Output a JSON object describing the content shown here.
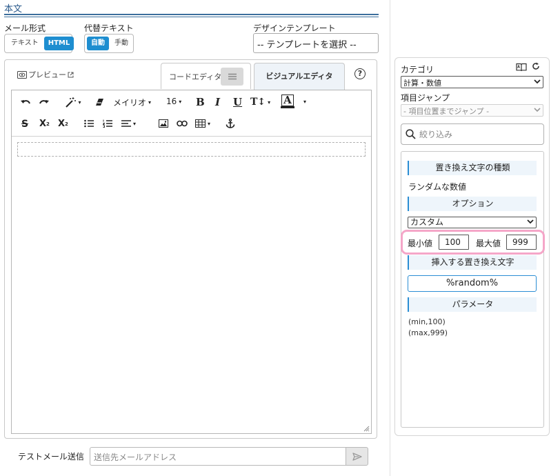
{
  "section": {
    "title": "本文"
  },
  "mail_format": {
    "label": "メール形式",
    "options": [
      "テキスト",
      "HTML"
    ],
    "selected": "HTML"
  },
  "alt_text": {
    "label": "代替テキスト",
    "options": [
      "自動",
      "手動"
    ],
    "selected": "自動"
  },
  "design_template": {
    "label": "デザインテンプレート",
    "value": "-- テンプレートを選択 --"
  },
  "editor_tabs": {
    "preview": "プレビュー",
    "code": "コードエディタ",
    "visual": "ビジュアルエディタ",
    "active": "ビジュアルエディタ",
    "help": "?"
  },
  "toolbar": {
    "font_name": "メイリオ",
    "font_size": "16",
    "bold": "B",
    "italic": "I",
    "underline": "U",
    "text_size": "T↕",
    "font_color": "A",
    "strike": "S",
    "superscript": "X",
    "sup_mark": "2",
    "subscript": "X",
    "sub_mark": "2",
    "icons": [
      "undo-icon",
      "redo-icon",
      "magic-wand-icon",
      "eraser-icon",
      "bullet-list-icon",
      "numbered-list-icon",
      "align-icon",
      "image-icon",
      "link-icon",
      "table-icon",
      "anchor-icon"
    ]
  },
  "test_mail": {
    "label": "テストメール送信",
    "placeholder": "送信先メールアドレス"
  },
  "right_panel": {
    "category_label": "カテゴリ",
    "category_value": "計算・数値",
    "jump_label": "項目ジャンプ",
    "jump_placeholder": "- 項目位置までジャンプ -",
    "search_placeholder": "絞り込み",
    "replace_type_heading": "置き換え文字の種類",
    "replace_type_value": "ランダムな数値",
    "option_heading": "オプション",
    "option_value": "カスタム",
    "min_label": "最小値",
    "min_value": "100",
    "max_label": "最大値",
    "max_value": "999",
    "insert_heading": "挿入する置き換え文字",
    "token": "%random%",
    "param_heading": "パラメータ",
    "params": [
      "(min,100)",
      "(max,999)"
    ]
  },
  "colors": {
    "accent": "#1e8ed0",
    "title": "#2a5a8c",
    "highlight": "#f5a6c8",
    "heading_bg": "#eef5fb"
  }
}
